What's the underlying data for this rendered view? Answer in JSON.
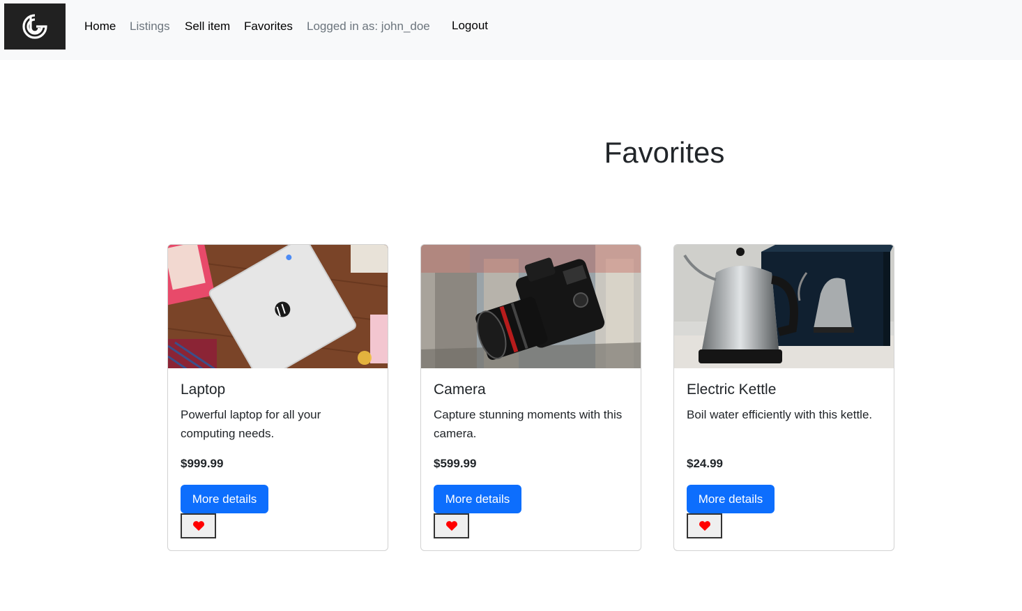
{
  "nav": {
    "logo_icon": "brand-logo-icon",
    "home": "Home",
    "listings": "Listings",
    "sell_item": "Sell item",
    "favorites": "Favorites",
    "logged_in": "Logged in as: john_doe",
    "logout": "Logout"
  },
  "page": {
    "title": "Favorites"
  },
  "cards": [
    {
      "title": "Laptop",
      "description": "Powerful laptop for all your computing needs.",
      "price": "$999.99",
      "button": "More details",
      "fav_icon": "heart-icon"
    },
    {
      "title": "Camera",
      "description": "Capture stunning moments with this camera.",
      "price": "$599.99",
      "button": "More details",
      "fav_icon": "heart-icon"
    },
    {
      "title": "Electric Kettle",
      "description": "Boil water efficiently with this kettle.",
      "price": "$24.99",
      "button": "More details",
      "fav_icon": "heart-icon"
    }
  ],
  "colors": {
    "primary": "#0d6efd",
    "heart": "#ff0000",
    "navbar": "#f8f9fa"
  }
}
